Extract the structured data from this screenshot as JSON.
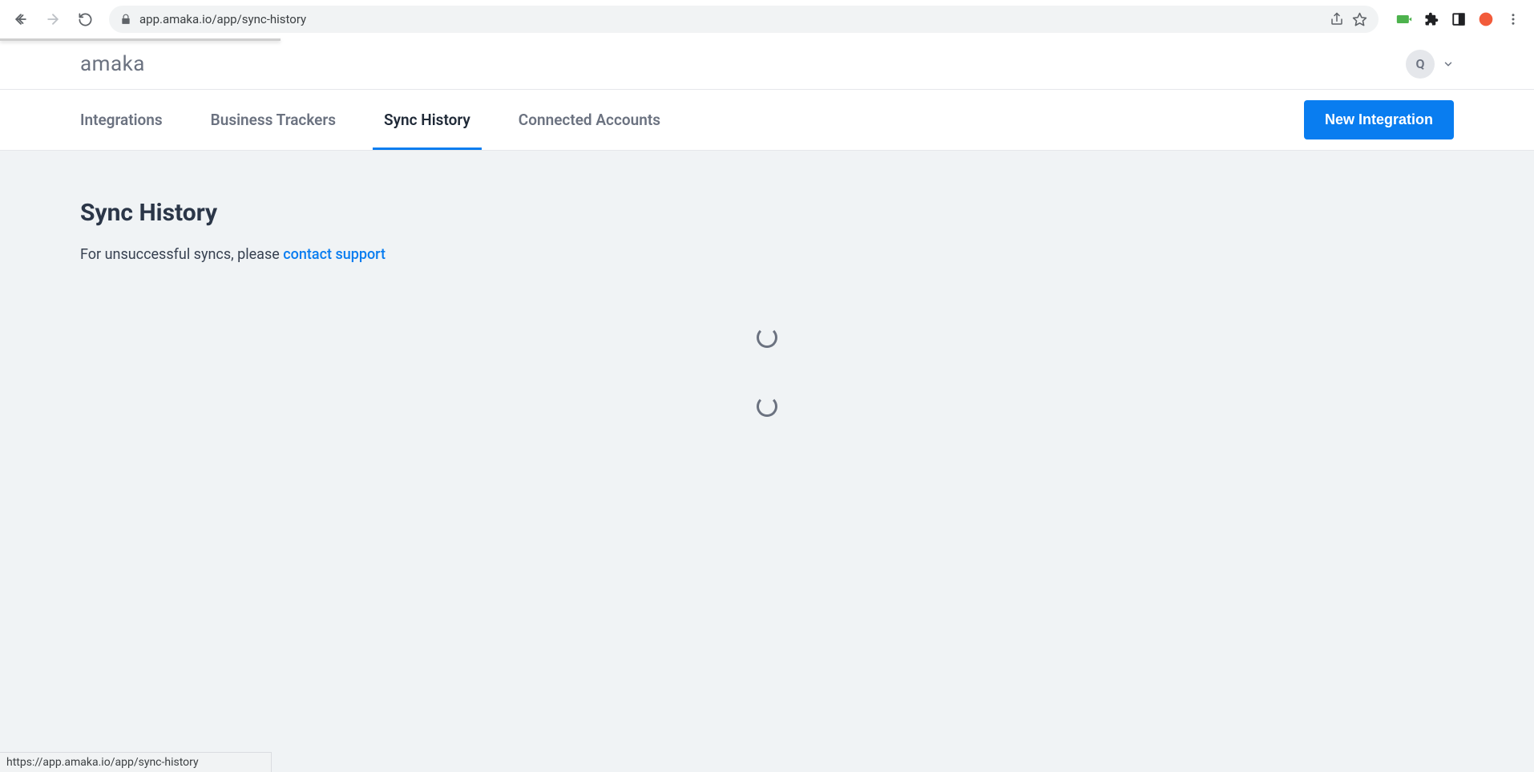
{
  "browser": {
    "url": "app.amaka.io/app/sync-history",
    "status_url": "https://app.amaka.io/app/sync-history"
  },
  "header": {
    "logo_text": "amaka",
    "avatar_initial": "Q"
  },
  "nav": {
    "tabs": [
      {
        "label": "Integrations",
        "active": false
      },
      {
        "label": "Business Trackers",
        "active": false
      },
      {
        "label": "Sync History",
        "active": true
      },
      {
        "label": "Connected Accounts",
        "active": false
      }
    ],
    "primary_button": "New Integration"
  },
  "page": {
    "title": "Sync History",
    "subtitle_prefix": "For unsuccessful syncs, please ",
    "subtitle_link": "contact support"
  }
}
